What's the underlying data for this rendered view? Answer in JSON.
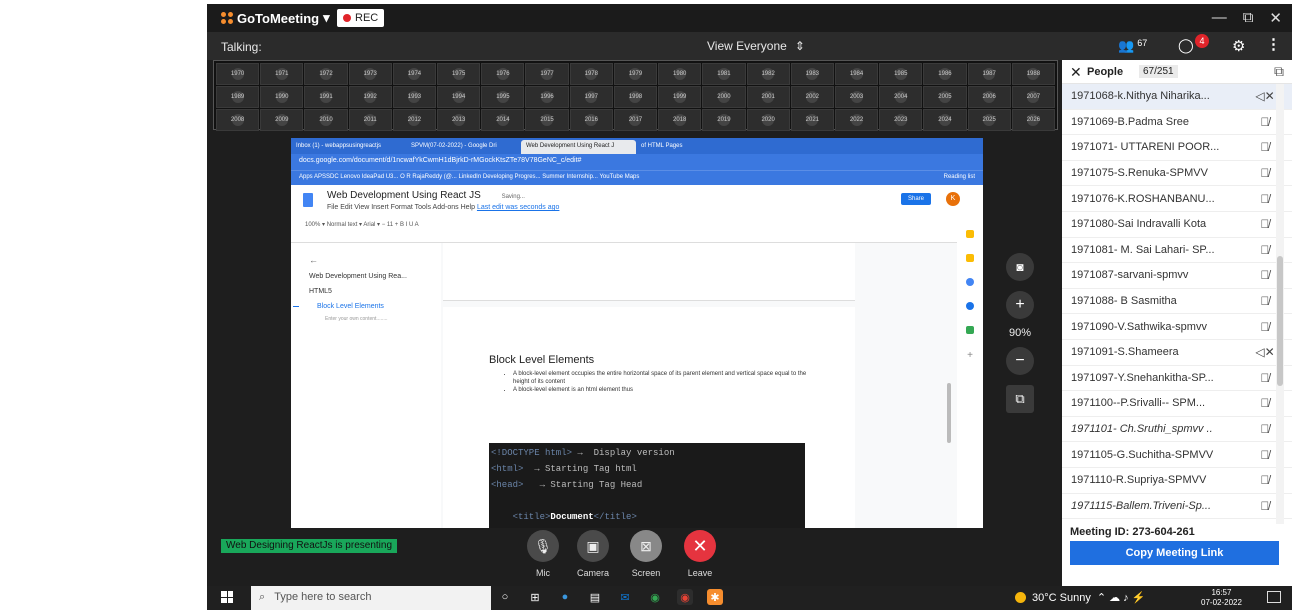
{
  "app": {
    "name": "GoToMeeting",
    "rec_label": "REC",
    "talking_label": "Talking:",
    "view_label": "View Everyone",
    "people_count": "67",
    "chat_badge": "4"
  },
  "thumbnails": [
    "1970",
    "1971",
    "1972",
    "1973",
    "1974",
    "1975",
    "1976",
    "1977",
    "1978",
    "1979",
    "1980",
    "1981",
    "1982",
    "1983",
    "1984",
    "1985",
    "1986",
    "1987",
    "1988",
    "1989",
    "1990",
    "1991",
    "1992",
    "1993",
    "1994",
    "1995",
    "1996",
    "1997",
    "1998",
    "1999",
    "2000",
    "2001",
    "2002",
    "2003",
    "2004",
    "2005",
    "2006",
    "2007",
    "2008",
    "2009",
    "2010",
    "2011",
    "2012",
    "2013",
    "2014",
    "2015",
    "2016",
    "2017",
    "2018",
    "2019",
    "2020",
    "2021",
    "2022",
    "2023",
    "2024",
    "2025",
    "2026"
  ],
  "shared_screen": {
    "tabs": [
      "Inbox (1) - webappsusingreactjs",
      "SPVM(07-02-2022) - Google Dri",
      "Web Development Using React J",
      "of HTML Pages"
    ],
    "url": "docs.google.com/document/d/1ncwafYkCwmH1dBjrkD-rMGockKtsZTe78V78GeNC_c/edit#",
    "bookmarks": "Apps   APSSDC   Lenovo IdeaPad U3...   O R RajaReddy (@...   LinkedIn   Developing Progres...   Summer Internship...   YouTube   Maps",
    "reading_list": "Reading list",
    "doc_title": "Web Development Using React JS",
    "saving": "Saving...",
    "menu": "File  Edit  View  Insert  Format  Tools  Add-ons  Help",
    "last_edit": "Last edit was seconds ago",
    "share_label": "Share",
    "avatar_letter": "K",
    "toolbar": "100%  ▾   Normal text  ▾   Arial  ▾   −  11  +   B  I  U  A",
    "outline": {
      "back": "←",
      "item1": "Web Development Using Rea...",
      "item2": "HTML5",
      "item3": "Block Level Elements",
      "item4": "Enter your own content........"
    },
    "heading": "Block Level Elements",
    "bullets": [
      "A block-level element occupies the entire horizontal space of its parent element and vertical space equal to the height of its content",
      "A block-level element is an html element thus"
    ],
    "code": {
      "line1_tag": "<!DOCTYPE html>",
      "line1_text": " →  Display version",
      "line2_tag": "<html>",
      "line2_text": "  → Starting Tag html",
      "line3_tag": "<head>",
      "line3_text": "   → Starting Tag Head",
      "line4_open": "<title>",
      "line4_bold": "Document",
      "line4_close": "</title>"
    }
  },
  "share_controls": {
    "zoom": "90%"
  },
  "people": {
    "label": "People",
    "count": "67/251",
    "list": [
      {
        "name": "1971068-k.Nithya Niharika...",
        "mic": "muted",
        "italic": false
      },
      {
        "name": "1971069-B.Padma Sree",
        "mic": "off",
        "italic": false
      },
      {
        "name": "1971071- UTTARENI POOR...",
        "mic": "off",
        "italic": false
      },
      {
        "name": "1971075-S.Renuka-SPMVV",
        "mic": "off",
        "italic": false
      },
      {
        "name": "1971076-K.ROSHANBANU...",
        "mic": "off",
        "italic": false
      },
      {
        "name": "1971080-Sai Indravalli Kota",
        "mic": "off",
        "italic": false
      },
      {
        "name": "1971081- M. Sai Lahari- SP...",
        "mic": "off",
        "italic": false
      },
      {
        "name": "1971087-sarvani-spmvv",
        "mic": "off",
        "italic": false
      },
      {
        "name": "1971088- B Sasmitha",
        "mic": "off",
        "italic": false
      },
      {
        "name": "1971090-V.Sathwika-spmvv",
        "mic": "off",
        "italic": false
      },
      {
        "name": "1971091-S.Shameera",
        "mic": "muted",
        "italic": false
      },
      {
        "name": "1971097-Y.Snehankitha-SP...",
        "mic": "off",
        "italic": false
      },
      {
        "name": "1971100--P.Srivalli-- SPM...",
        "mic": "off",
        "italic": false
      },
      {
        "name": "1971101- Ch.Sruthi_spmvv ..",
        "mic": "off",
        "italic": true
      },
      {
        "name": "1971105-G.Suchitha-SPMVV",
        "mic": "off",
        "italic": false
      },
      {
        "name": "1971110-R.Supriya-SPMVV",
        "mic": "off",
        "italic": false
      },
      {
        "name": "1971115-Ballem.Triveni-Sp...",
        "mic": "off",
        "italic": true
      }
    ],
    "meeting_id": "Meeting ID: 273-604-261",
    "copy_link": "Copy Meeting Link"
  },
  "bottom": {
    "presenting": "Web Designing ReactJs is presenting",
    "mic": "Mic",
    "camera": "Camera",
    "screen": "Screen",
    "leave": "Leave"
  },
  "taskbar": {
    "search_placeholder": "Type here to search",
    "weather": "30°C  Sunny",
    "time": "16:57",
    "date": "07-02-2022"
  },
  "colors": {
    "brand_orange": "#f68d2e",
    "rec_red": "#e0242a",
    "link_blue": "#1f6fe0",
    "presenting_green": "#19a75a",
    "leave_red": "#e5343f"
  }
}
